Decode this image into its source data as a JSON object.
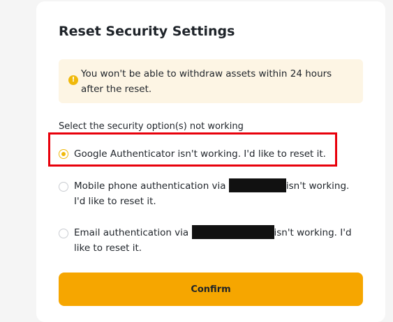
{
  "header": {
    "title": "Reset Security Settings"
  },
  "warning": {
    "icon": "alert-circle-icon",
    "text": "You won't be able to withdraw assets within 24 hours after the reset."
  },
  "prompt": "Select the security option(s) not working",
  "options": [
    {
      "selected": true,
      "text": "Google Authenticator isn't working. I'd like to reset it."
    },
    {
      "selected": false,
      "prefix": "Mobile phone authentication via",
      "suffix": "isn't working. I'd like to reset it."
    },
    {
      "selected": false,
      "prefix": "Email authentication via",
      "suffix": "isn't working. I'd like to reset it."
    }
  ],
  "confirm_label": "Confirm",
  "colors": {
    "accent": "#f0b90b",
    "button": "#f6a600",
    "warning_bg": "#fdf5e4",
    "highlight": "#e8000b"
  }
}
